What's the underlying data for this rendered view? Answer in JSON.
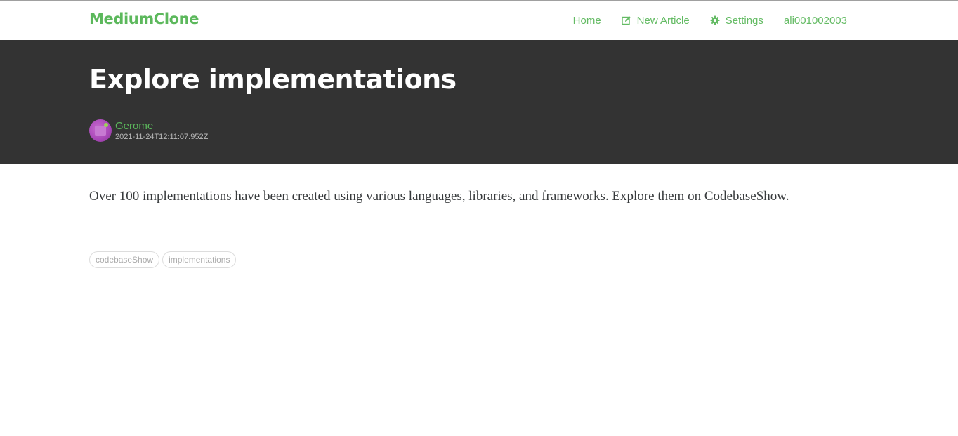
{
  "navbar": {
    "brand": "MediumClone",
    "items": [
      {
        "label": "Home",
        "icon": ""
      },
      {
        "label": "New Article",
        "icon": "compose-icon"
      },
      {
        "label": "Settings",
        "icon": "gear-icon"
      },
      {
        "label": "ali001002003",
        "icon": ""
      }
    ]
  },
  "article": {
    "title": "Explore implementations",
    "author": "Gerome",
    "date": "2021-11-24T12:11:07.952Z",
    "body": "Over 100 implementations have been created using various languages, libraries, and frameworks. Explore them on CodebaseShow.",
    "tags": [
      "codebaseShow",
      "implementations"
    ]
  },
  "colors": {
    "accent": "#5cb85c",
    "banner": "#333333",
    "body_text": "#373a3c",
    "tag_text": "#aaaaaa"
  }
}
